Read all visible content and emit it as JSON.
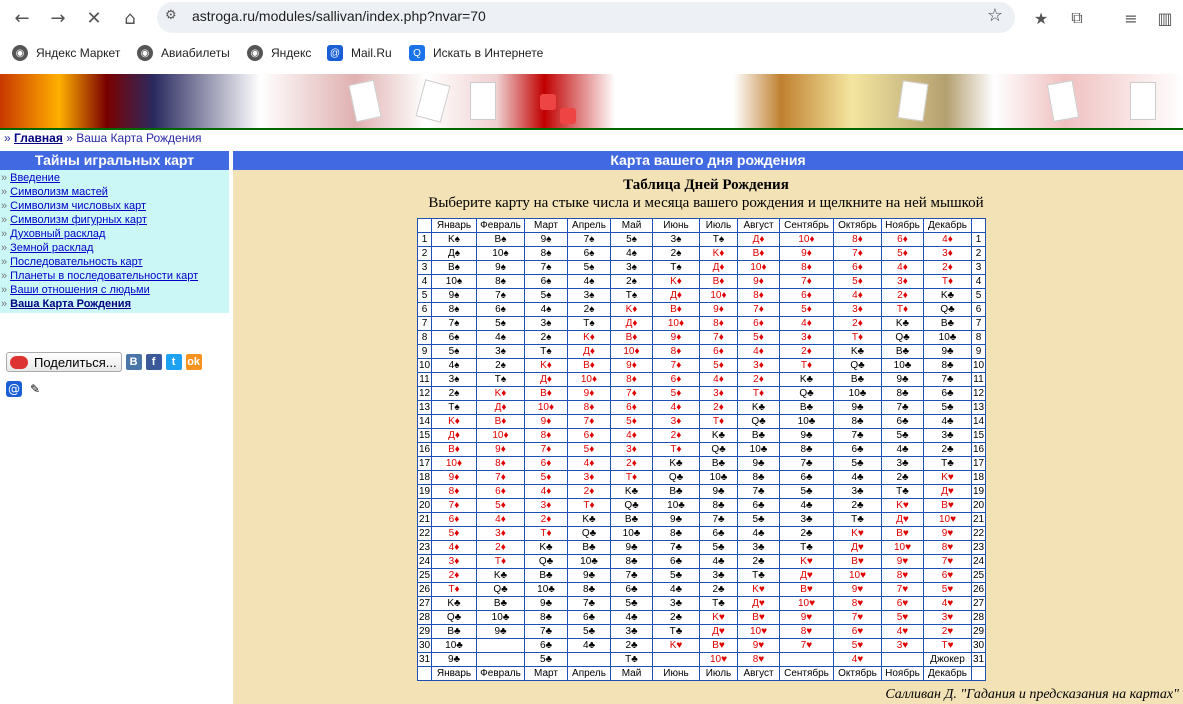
{
  "browser": {
    "url": "astroga.ru/modules/sallivan/index.php?nvar=70",
    "bookmarks": [
      "Яндекс Маркет",
      "Авиабилеты",
      "Яндекс",
      "Mail.Ru",
      "Искать в Интернете"
    ]
  },
  "breadcrumb": {
    "home": "Главная",
    "sep": "»",
    "current": "Ваша Карта Рождения"
  },
  "sidebar": {
    "title": "Тайны игральных карт",
    "bullet": "»",
    "items": [
      "Введение",
      "Символизм мастей",
      "Символизм числовых карт",
      "Символизм фигурных карт",
      "Духовный расклад",
      "Земной расклад",
      "Последовательность карт",
      "Планеты в последовательности карт",
      "Ваши отношения с людьми",
      "Ваша Карта Рождения"
    ],
    "active_index": 9,
    "share_label": "Поделиться...",
    "social": [
      "В",
      "f",
      "t",
      "ok"
    ]
  },
  "main": {
    "header": "Карта вашего дня рождения",
    "title": "Таблица Дней Рождения",
    "subtitle": "Выберите карту на стыке числа и месяца вашего рождения и щелкните на ней мышкой",
    "credit": "Салливан Д. \"Гадания и предсказания на картах\""
  },
  "table": {
    "months": [
      "Январь",
      "Февраль",
      "Март",
      "Апрель",
      "Май",
      "Июнь",
      "Июль",
      "Август",
      "Сентябрь",
      "Октябрь",
      "Ноябрь",
      "Декабрь"
    ],
    "rows": [
      [
        "K♠",
        "В♠",
        "9♠",
        "7♠",
        "5♠",
        "3♠",
        "Т♠",
        "Д♦",
        "10♦",
        "8♦",
        "6♦",
        "4♦"
      ],
      [
        "Д♠",
        "10♠",
        "8♠",
        "6♠",
        "4♠",
        "2♠",
        "K♦",
        "В♦",
        "9♦",
        "7♦",
        "5♦",
        "3♦"
      ],
      [
        "В♠",
        "9♠",
        "7♠",
        "5♠",
        "3♠",
        "Т♠",
        "Д♦",
        "10♦",
        "8♦",
        "6♦",
        "4♦",
        "2♦"
      ],
      [
        "10♠",
        "8♠",
        "6♠",
        "4♠",
        "2♠",
        "K♦",
        "В♦",
        "9♦",
        "7♦",
        "5♦",
        "3♦",
        "Т♦"
      ],
      [
        "9♠",
        "7♠",
        "5♠",
        "3♠",
        "Т♠",
        "Д♦",
        "10♦",
        "8♦",
        "6♦",
        "4♦",
        "2♦",
        "K♣"
      ],
      [
        "8♠",
        "6♠",
        "4♠",
        "2♠",
        "K♦",
        "В♦",
        "9♦",
        "7♦",
        "5♦",
        "3♦",
        "Т♦",
        "Q♣"
      ],
      [
        "7♠",
        "5♠",
        "3♠",
        "Т♠",
        "Д♦",
        "10♦",
        "8♦",
        "6♦",
        "4♦",
        "2♦",
        "K♣",
        "В♣"
      ],
      [
        "6♠",
        "4♠",
        "2♠",
        "K♦",
        "В♦",
        "9♦",
        "7♦",
        "5♦",
        "3♦",
        "Т♦",
        "Q♣",
        "10♣"
      ],
      [
        "5♠",
        "3♠",
        "Т♠",
        "Д♦",
        "10♦",
        "8♦",
        "6♦",
        "4♦",
        "2♦",
        "K♣",
        "В♣",
        "9♣"
      ],
      [
        "4♠",
        "2♠",
        "K♦",
        "В♦",
        "9♦",
        "7♦",
        "5♦",
        "3♦",
        "Т♦",
        "Q♣",
        "10♣",
        "8♣"
      ],
      [
        "3♠",
        "Т♠",
        "Д♦",
        "10♦",
        "8♦",
        "6♦",
        "4♦",
        "2♦",
        "K♣",
        "В♣",
        "9♣",
        "7♣"
      ],
      [
        "2♠",
        "K♦",
        "В♦",
        "9♦",
        "7♦",
        "5♦",
        "3♦",
        "Т♦",
        "Q♣",
        "10♣",
        "8♣",
        "6♣"
      ],
      [
        "Т♠",
        "Д♦",
        "10♦",
        "8♦",
        "6♦",
        "4♦",
        "2♦",
        "K♣",
        "В♣",
        "9♣",
        "7♣",
        "5♣"
      ],
      [
        "K♦",
        "В♦",
        "9♦",
        "7♦",
        "5♦",
        "3♦",
        "Т♦",
        "Q♣",
        "10♣",
        "8♣",
        "6♣",
        "4♣"
      ],
      [
        "Д♦",
        "10♦",
        "8♦",
        "6♦",
        "4♦",
        "2♦",
        "K♣",
        "В♣",
        "9♣",
        "7♣",
        "5♣",
        "3♣"
      ],
      [
        "В♦",
        "9♦",
        "7♦",
        "5♦",
        "3♦",
        "Т♦",
        "Q♣",
        "10♣",
        "8♣",
        "6♣",
        "4♣",
        "2♣"
      ],
      [
        "10♦",
        "8♦",
        "6♦",
        "4♦",
        "2♦",
        "K♣",
        "В♣",
        "9♣",
        "7♣",
        "5♣",
        "3♣",
        "Т♣"
      ],
      [
        "9♦",
        "7♦",
        "5♦",
        "3♦",
        "Т♦",
        "Q♣",
        "10♣",
        "8♣",
        "6♣",
        "4♣",
        "2♣",
        "K♥"
      ],
      [
        "8♦",
        "6♦",
        "4♦",
        "2♦",
        "K♣",
        "В♣",
        "9♣",
        "7♣",
        "5♣",
        "3♣",
        "Т♣",
        "Д♥"
      ],
      [
        "7♦",
        "5♦",
        "3♦",
        "Т♦",
        "Q♣",
        "10♣",
        "8♣",
        "6♣",
        "4♣",
        "2♣",
        "K♥",
        "В♥"
      ],
      [
        "6♦",
        "4♦",
        "2♦",
        "K♣",
        "В♣",
        "9♣",
        "7♣",
        "5♣",
        "3♣",
        "Т♣",
        "Д♥",
        "10♥"
      ],
      [
        "5♦",
        "3♦",
        "Т♦",
        "Q♣",
        "10♣",
        "8♣",
        "6♣",
        "4♣",
        "2♣",
        "K♥",
        "В♥",
        "9♥"
      ],
      [
        "4♦",
        "2♦",
        "K♣",
        "В♣",
        "9♣",
        "7♣",
        "5♣",
        "3♣",
        "Т♣",
        "Д♥",
        "10♥",
        "8♥"
      ],
      [
        "3♦",
        "Т♦",
        "Q♣",
        "10♣",
        "8♣",
        "6♣",
        "4♣",
        "2♣",
        "K♥",
        "В♥",
        "9♥",
        "7♥"
      ],
      [
        "2♦",
        "K♣",
        "В♣",
        "9♣",
        "7♣",
        "5♣",
        "3♣",
        "Т♣",
        "Д♥",
        "10♥",
        "8♥",
        "6♥"
      ],
      [
        "Т♦",
        "Q♣",
        "10♣",
        "8♣",
        "6♣",
        "4♣",
        "2♣",
        "K♥",
        "В♥",
        "9♥",
        "7♥",
        "5♥"
      ],
      [
        "K♣",
        "В♣",
        "9♣",
        "7♣",
        "5♣",
        "3♣",
        "Т♣",
        "Д♥",
        "10♥",
        "8♥",
        "6♥",
        "4♥"
      ],
      [
        "Q♣",
        "10♣",
        "8♣",
        "6♣",
        "4♣",
        "2♣",
        "K♥",
        "В♥",
        "9♥",
        "7♥",
        "5♥",
        "3♥"
      ],
      [
        "В♣",
        "9♣",
        "7♣",
        "5♣",
        "3♣",
        "Т♣",
        "Д♥",
        "10♥",
        "8♥",
        "6♥",
        "4♥",
        "2♥"
      ],
      [
        "10♣",
        "",
        "6♣",
        "4♣",
        "2♣",
        "K♥",
        "В♥",
        "9♥",
        "7♥",
        "5♥",
        "3♥",
        "Т♥"
      ],
      [
        "9♣",
        "",
        "5♣",
        "",
        "Т♣",
        "",
        "10♥",
        "8♥",
        "",
        "4♥",
        "",
        "Джокер"
      ]
    ]
  },
  "colors": {
    "accent": "#4169e1",
    "menu_bg": "#ccf7f7",
    "main_bg": "#f2e2b6",
    "red_suit": "#e00000",
    "link": "#0000c8"
  }
}
